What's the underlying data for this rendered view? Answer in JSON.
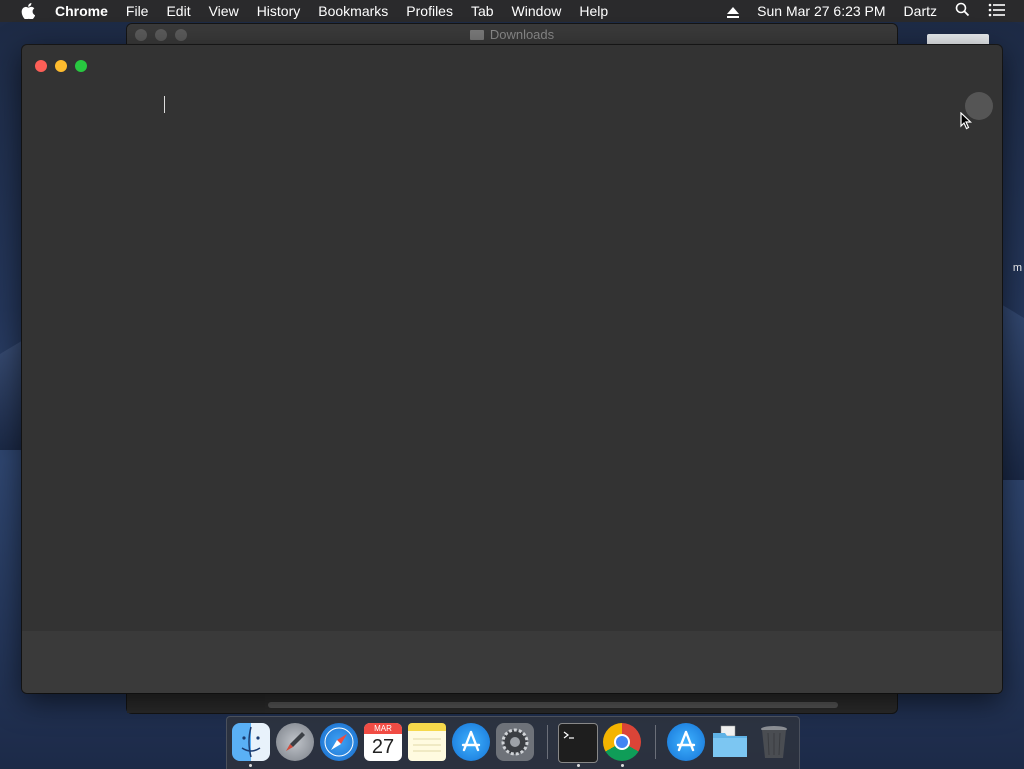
{
  "menubar": {
    "app_name": "Chrome",
    "items": [
      "File",
      "Edit",
      "View",
      "History",
      "Bookmarks",
      "Profiles",
      "Tab",
      "Window",
      "Help"
    ],
    "datetime": "Sun Mar 27  6:23 PM",
    "user": "Dartz"
  },
  "background_window": {
    "title": "Downloads"
  },
  "desktop": {
    "partial_label": "m"
  },
  "dock": {
    "calendar_month": "MAR",
    "calendar_day": "27",
    "apps": [
      "finder",
      "launchpad",
      "safari",
      "calendar",
      "notes",
      "app-store",
      "system-preferences",
      "terminal",
      "chrome",
      "app-store-2",
      "folder",
      "trash"
    ]
  },
  "colors": {
    "window_bg": "#333333",
    "close": "#fd5f57",
    "minimize": "#febc2e",
    "zoom": "#28c840"
  }
}
